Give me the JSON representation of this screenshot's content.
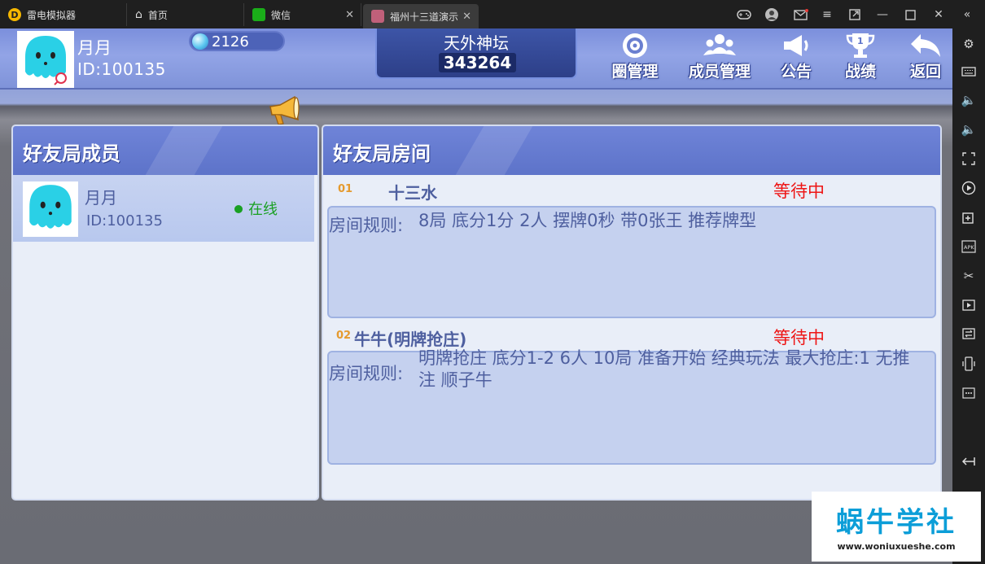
{
  "emulator": {
    "tabs": [
      {
        "label": "雷电模拟器"
      },
      {
        "label": "首页"
      },
      {
        "label": "微信"
      },
      {
        "label": "福州十三道演示"
      }
    ]
  },
  "header": {
    "player_name": "月月",
    "player_id": "ID:100135",
    "diamonds": "2126",
    "banner_title": "天外神坛",
    "banner_number": "343264",
    "nav": {
      "circle_manage": "圈管理",
      "member_manage": "成员管理",
      "notice": "公告",
      "record": "战绩",
      "back": "返回"
    }
  },
  "members_panel": {
    "title": "好友局成员",
    "members": [
      {
        "name": "月月",
        "id": "ID:100135",
        "status": "在线"
      }
    ]
  },
  "rooms_panel": {
    "title": "好友局房间",
    "rooms": [
      {
        "num": "01",
        "name": "十三水",
        "status": "等待中",
        "rules_label": "房间规则:",
        "rules": "8局 底分1分 2人 摆牌0秒 带0张王 推荐牌型"
      },
      {
        "num": "02",
        "name": "牛牛(明牌抢庄)",
        "status": "等待中",
        "rules_label": "房间规则:",
        "rules": "明牌抢庄 底分1-2 6人 10局 准备开始 经典玩法 最大抢庄:1 无推注 顺子牛"
      }
    ]
  },
  "watermark": {
    "title": "蜗牛学社",
    "url": "www.woniuxueshe.com"
  },
  "colors": {
    "header_blue": "#7b8fdc",
    "panel_bg": "#e9eef8",
    "text_blue": "#4e5f9f",
    "status_red": "#ee1515",
    "online_green": "#1aa023"
  }
}
